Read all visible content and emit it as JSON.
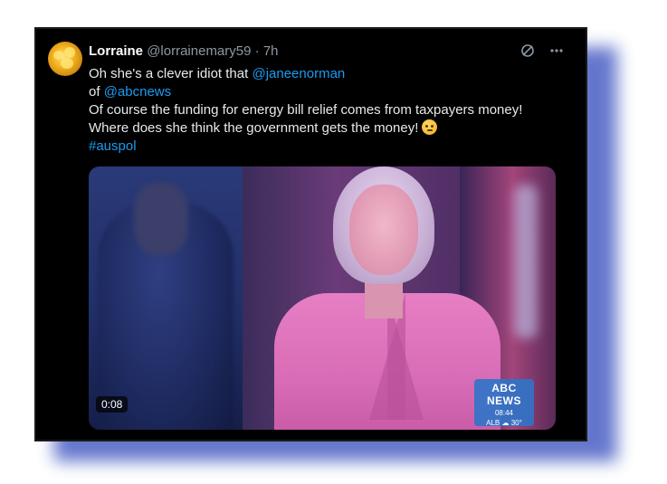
{
  "tweet": {
    "author_name": "Lorraine",
    "handle": "@lorrainemary59",
    "separator": "·",
    "time": "7h",
    "line1_text": "Oh she's a clever idiot that ",
    "mention_janeenorman": "@janeenorman",
    "line2_text": "of ",
    "mention_abcnews": "@abcnews",
    "line3_text": "Of course the funding for energy bill relief comes from taxpayers money!",
    "line4_text": "Where does she think the government gets the money!",
    "emoji_name": "thinking-face",
    "hashtag": "#auspol"
  },
  "actions": {
    "icons": [
      "grok-icon",
      "more-icon"
    ]
  },
  "video": {
    "timecode": "0:08",
    "badge": {
      "brand": "ABC NEWS",
      "time": "08:44",
      "location": "ALB",
      "temperature": "30°"
    }
  },
  "colors": {
    "background": "#000000",
    "link": "#1d9bf0",
    "text": "#e7e9ea",
    "muted": "#8b98a5",
    "shadow": "#4a5fc4"
  }
}
